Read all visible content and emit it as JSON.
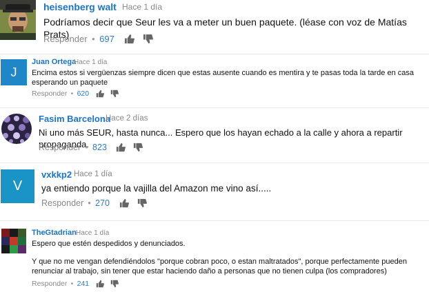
{
  "comments": [
    {
      "author": "heisenberg walt",
      "time": "Hace 1 día",
      "text": "Podríamos decir que Seur les va a meter un buen paquete. (léase con voz de Matías Prats)",
      "reply_label": "Responder",
      "likes": "697",
      "avatar_type": "image",
      "avatar_desc": "portrait-photo"
    },
    {
      "author": "Juan Ortega",
      "time": "Hace 1 día",
      "text": "Encima estos si vergüenzas siempre dicen que estas ausente cuando es mentira y te pasas toda la tarde en casa esperando un paquete",
      "reply_label": "Responder",
      "likes": "620",
      "avatar_type": "letter",
      "avatar_letter": "J",
      "avatar_color": "#1f86c7"
    },
    {
      "author": "Fasim Barcelona",
      "time": "Hace 2 días",
      "text": "Ni uno más SEUR, hasta nunca... Espero que los hayan echado a la calle y ahora a repartir propaganda.",
      "reply_label": "Responder",
      "likes": "823",
      "avatar_type": "image",
      "avatar_desc": "purple-pattern"
    },
    {
      "author": "vxkkp2",
      "time": "Hace 1 día",
      "text": "ya entiendo porque la vajilla del Amazon me vino así.....",
      "reply_label": "Responder",
      "likes": "270",
      "avatar_type": "letter",
      "avatar_letter": "V",
      "avatar_color": "#1a93c7"
    },
    {
      "author": "TheGtadrian",
      "time": "Hace 1 día",
      "text": "Espero que estén despedidos y denunciados.",
      "text2": "Y que no me vengan  defendiéndolos \"porque cobran poco, o estan maltratados\", porque perfectamente pueden renunciar al trabajo, sin tener que estar haciendo daño a personas que no tienen culpa (los compradores)",
      "reply_label": "Responder",
      "likes": "241",
      "avatar_type": "image",
      "avatar_desc": "pixel-pattern"
    }
  ],
  "icons": {
    "like": "thumbs-up-icon",
    "dislike": "thumbs-down-icon"
  },
  "colors": {
    "author": "#1a73c9",
    "likes": "#2a7bd3",
    "muted": "#888888"
  }
}
